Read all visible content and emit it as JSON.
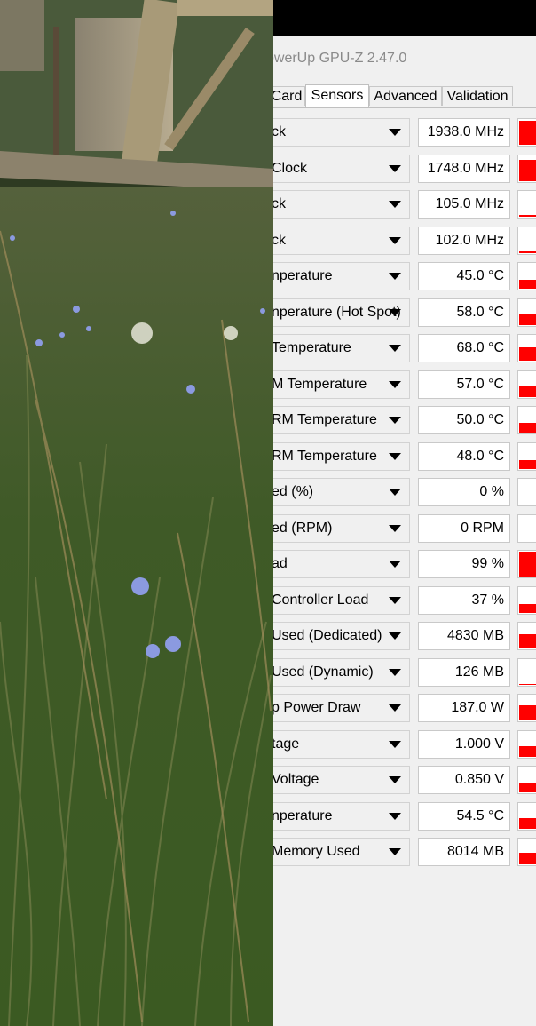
{
  "window": {
    "title": "owerUp GPU-Z 2.47.0"
  },
  "tabs": [
    {
      "label": "Card",
      "active": false
    },
    {
      "label": "Sensors",
      "active": true
    },
    {
      "label": "Advanced",
      "active": false
    },
    {
      "label": "Validation",
      "active": false
    }
  ],
  "colors": {
    "graph_fill": "#ff0000",
    "window_bg": "#f0f0f0"
  },
  "sensors": [
    {
      "label": "ck",
      "value": "1938.0 MHz",
      "level": 0.92
    },
    {
      "label": "Clock",
      "value": "1748.0 MHz",
      "level": 0.82
    },
    {
      "label": "ck",
      "value": "105.0 MHz",
      "level": 0.08
    },
    {
      "label": "ck",
      "value": "102.0 MHz",
      "level": 0.08
    },
    {
      "label": "nperature",
      "value": "45.0 °C",
      "level": 0.35
    },
    {
      "label": "nperature (Hot Spot)",
      "value": "58.0 °C",
      "level": 0.45
    },
    {
      "label": "Temperature",
      "value": "68.0 °C",
      "level": 0.52
    },
    {
      "label": "M Temperature",
      "value": "57.0 °C",
      "level": 0.44
    },
    {
      "label": "RM Temperature",
      "value": "50.0 °C",
      "level": 0.38
    },
    {
      "label": "RM Temperature",
      "value": "48.0 °C",
      "level": 0.36
    },
    {
      "label": "ed (%)",
      "value": "0 %",
      "level": 0.0
    },
    {
      "label": "ed (RPM)",
      "value": "0 RPM",
      "level": 0.0
    },
    {
      "label": "ad",
      "value": "99 %",
      "level": 0.97
    },
    {
      "label": "Controller Load",
      "value": "37 %",
      "level": 0.35
    },
    {
      "label": "Used (Dedicated)",
      "value": "4830 MB",
      "level": 0.55
    },
    {
      "label": "Used (Dynamic)",
      "value": "126 MB",
      "level": 0.03
    },
    {
      "label": "p Power Draw",
      "value": "187.0 W",
      "level": 0.6
    },
    {
      "label": "tage",
      "value": "1.000 V",
      "level": 0.4
    },
    {
      "label": "Voltage",
      "value": "0.850 V",
      "level": 0.33
    },
    {
      "label": "nperature",
      "value": "54.5 °C",
      "level": 0.4
    },
    {
      "label": "Memory Used",
      "value": "8014 MB",
      "level": 0.45
    }
  ]
}
